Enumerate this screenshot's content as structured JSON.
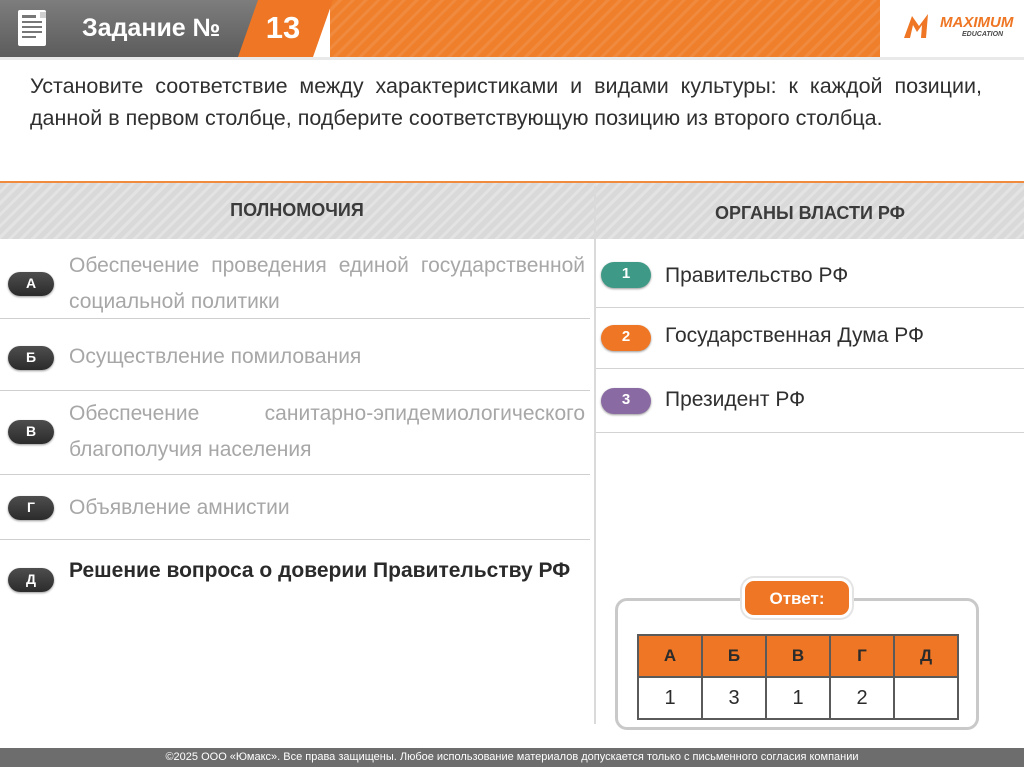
{
  "header": {
    "title": "Задание №",
    "number": "13",
    "logo_main": "MAXIMUM",
    "logo_sub": "EDUCATION",
    "icon": "document-icon"
  },
  "question": "Установите соответствие между характеристиками и видами культуры: к каждой позиции, данной в первом столбце, подберите соответствующую позицию из второго столбца.",
  "columns": {
    "left": "ПОЛНОМОЧИЯ",
    "right": "ОРГАНЫ ВЛАСТИ РФ"
  },
  "items": [
    {
      "letter": "А",
      "text": "Обеспечение проведения единой государственной социальной политики"
    },
    {
      "letter": "Б",
      "text": "Осуществление помилования"
    },
    {
      "letter": "В",
      "text": "Обеспечение санитарно-эпидемиологического благополучия населения"
    },
    {
      "letter": "Г",
      "text": "Объявление амнистии"
    },
    {
      "letter": "Д",
      "text": "Решение вопроса о доверии Правительству РФ"
    }
  ],
  "options": [
    {
      "number": "1",
      "text": "Правительство РФ",
      "color": "#3e9a86"
    },
    {
      "number": "2",
      "text": "Государственная Дума РФ",
      "color": "#ee7624"
    },
    {
      "number": "3",
      "text": "Президент РФ",
      "color": "#8a6aa3"
    }
  ],
  "answer": {
    "label": "Ответ:",
    "headers": [
      "А",
      "Б",
      "В",
      "Г",
      "Д"
    ],
    "values": [
      "1",
      "3",
      "1",
      "2",
      ""
    ]
  },
  "footer": "©2025 ООО «Юмакс». Все права защищены. Любое использование материалов допускается только с  письменного согласия компании",
  "colors": {
    "accent": "#ee7624",
    "header_gray": "#6b6b6b"
  }
}
